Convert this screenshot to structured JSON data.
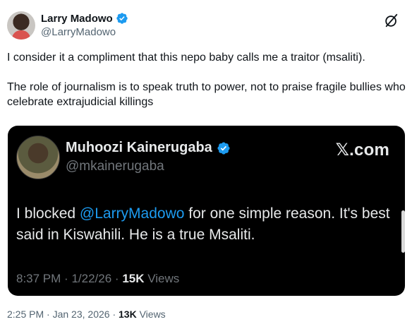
{
  "author": {
    "display_name": "Larry Madowo",
    "handle": "@LarryMadowo",
    "verified_color": "#1d9bf0"
  },
  "tweet": {
    "paragraph_1": "I consider it a compliment that this nepo baby calls me a traitor (msaliti).",
    "paragraph_2": "The role of journalism is to speak truth to power, not to praise fragile bullies who celebrate extrajudicial killings",
    "time": "2:25 PM",
    "separator": "·",
    "date": "Jan 23, 2026",
    "views_count": "13K",
    "views_label": "Views"
  },
  "embedded": {
    "display_name": "Muhoozi Kainerugaba",
    "handle": "@mkainerugaba",
    "source": "𝕏.com",
    "text_before": "I blocked ",
    "mention": "@LarryMadowo",
    "text_after": " for one simple reason. It's best said in Kiswahili. He is a true Msaliti.",
    "time": "8:37 PM",
    "separator": "·",
    "date": "1/22/26",
    "views_count": "15K",
    "views_label": "Views"
  },
  "icons": {
    "grok": "grok-icon",
    "verified": "verified-badge-icon"
  }
}
